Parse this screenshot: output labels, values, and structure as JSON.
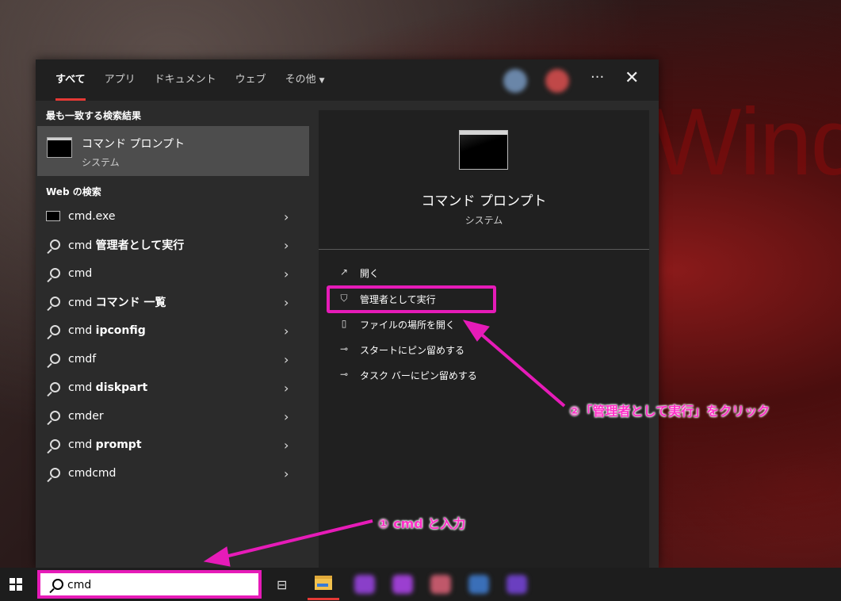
{
  "wallpaper_text": "Windo",
  "tabs": [
    {
      "label": "すべて"
    },
    {
      "label": "アプリ"
    },
    {
      "label": "ドキュメント"
    },
    {
      "label": "ウェブ"
    },
    {
      "label": "その他"
    }
  ],
  "tab_more_caret": "▼",
  "more_label": "···",
  "close_label": "✕",
  "best_match": {
    "section_label": "最も一致する検索結果",
    "title": "コマンド プロンプト",
    "subtitle": "システム"
  },
  "web_section_label": "Web の検索",
  "web_items": [
    {
      "icon": "cmd-app-icon",
      "prefix": "cmd.exe",
      "bold": ""
    },
    {
      "icon": "search-icon",
      "prefix": "cmd ",
      "bold": "管理者として実行"
    },
    {
      "icon": "search-icon",
      "prefix": "cmd",
      "bold": ""
    },
    {
      "icon": "search-icon",
      "prefix": "cmd ",
      "bold": "コマンド 一覧"
    },
    {
      "icon": "search-icon",
      "prefix": "cmd ",
      "bold": "ipconfig"
    },
    {
      "icon": "search-icon",
      "prefix": "cmdf",
      "bold": ""
    },
    {
      "icon": "search-icon",
      "prefix": "cmd ",
      "bold": "diskpart"
    },
    {
      "icon": "search-icon",
      "prefix": "cmder",
      "bold": ""
    },
    {
      "icon": "search-icon",
      "prefix": "cmd ",
      "bold": "prompt"
    },
    {
      "icon": "search-icon",
      "prefix": "cmdcmd",
      "bold": ""
    }
  ],
  "chevron": "›",
  "preview": {
    "title": "コマンド プロンプト",
    "subtitle": "システム"
  },
  "actions": [
    {
      "icon": "open-icon",
      "glyph": "↗",
      "label": "開く"
    },
    {
      "icon": "shield-icon",
      "glyph": "⛉",
      "label": "管理者として実行"
    },
    {
      "icon": "file-location-icon",
      "glyph": "▯",
      "label": "ファイルの場所を開く"
    },
    {
      "icon": "pin-icon",
      "glyph": "⊸",
      "label": "スタートにピン留めする"
    },
    {
      "icon": "pin-icon",
      "glyph": "⊸",
      "label": "タスク バーにピン留めする"
    }
  ],
  "search": {
    "value": "cmd"
  },
  "taskview_glyph": "⊟",
  "annotations": {
    "step1": "① cmd と入力",
    "step2": "②「管理者として実行」をクリック"
  },
  "colors": {
    "highlight": "#e61bb8",
    "accent": "#e53935"
  }
}
